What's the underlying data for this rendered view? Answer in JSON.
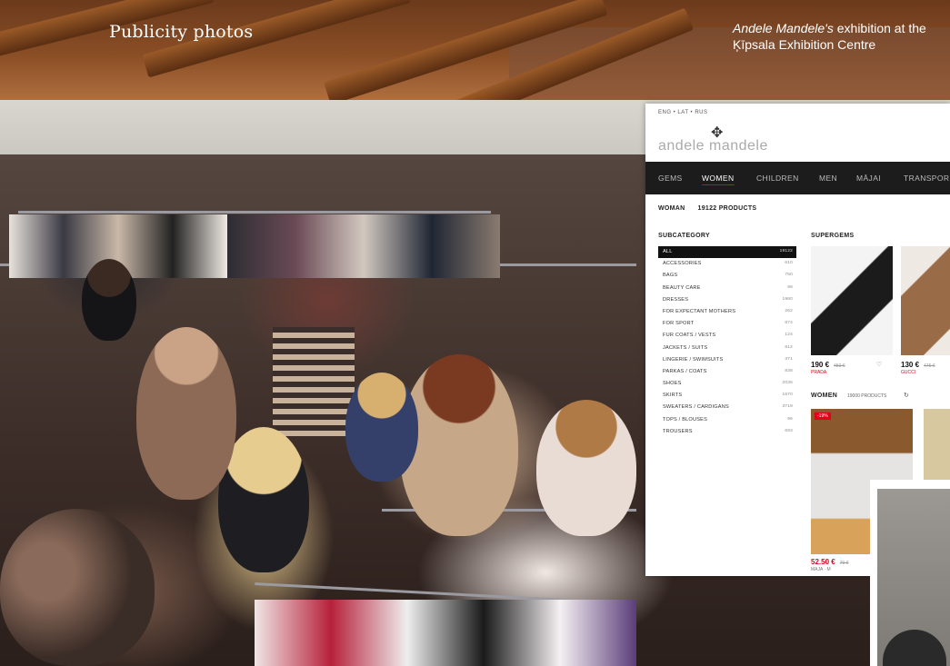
{
  "captions": {
    "left": "Publicity photos",
    "right_italic": "Andele Mandele's",
    "right_rest": " exhibition at the Ķīpsala Exhibition Centre"
  },
  "website": {
    "languages": "ENG  •  LAT  •  RUS",
    "logo_text": "andele mandele",
    "nav": [
      "GEMS",
      "WOMEN",
      "CHILDREN",
      "MEN",
      "MĀJAI",
      "TRANSPOR"
    ],
    "active_nav": "WOMEN",
    "breadcrumb": {
      "section": "WOMAN",
      "count": "19122 PRODUCTS"
    },
    "subcategory_title": "SUBCATEGORY",
    "subcategories": [
      {
        "label": "ALL",
        "count": "19122"
      },
      {
        "label": "ACCESSORIES",
        "count": "610"
      },
      {
        "label": "BAGS",
        "count": "750"
      },
      {
        "label": "BEAUTY CARE",
        "count": "98"
      },
      {
        "label": "DRESSES",
        "count": "1960"
      },
      {
        "label": "FOR EXPECTANT MOTHERS",
        "count": "262"
      },
      {
        "label": "FOR SPORT",
        "count": "874"
      },
      {
        "label": "FUR COATS / VESTS",
        "count": "124"
      },
      {
        "label": "JACKETS / SUITS",
        "count": "812"
      },
      {
        "label": "LINGERIE / SWIMSUITS",
        "count": "371"
      },
      {
        "label": "PARKAS / COATS",
        "count": "838"
      },
      {
        "label": "SHOES",
        "count": "2036"
      },
      {
        "label": "SKIRTS",
        "count": "1670"
      },
      {
        "label": "SWEATERS / CARDIGANS",
        "count": "3719"
      },
      {
        "label": "TOPS / BLOUSES",
        "count": "96"
      },
      {
        "label": "TROUSERS",
        "count": "693"
      }
    ],
    "supergems_title": "SUPERGEMS",
    "supergems": [
      {
        "price": "190 €",
        "old": "450 €",
        "sale": "PRADA"
      },
      {
        "price": "130 €",
        "old": "475 €",
        "sale": "GUCCI"
      }
    ],
    "women_title": "WOMEN",
    "women_count": "19000 PRODUCTS",
    "women_cards": [
      {
        "badge": "-19%",
        "price": "52.50 €",
        "old": "70 €",
        "note": "MAJA · M"
      }
    ]
  },
  "colors": {
    "accent": "#e1001a",
    "nav_bg": "#1c1c1c"
  }
}
